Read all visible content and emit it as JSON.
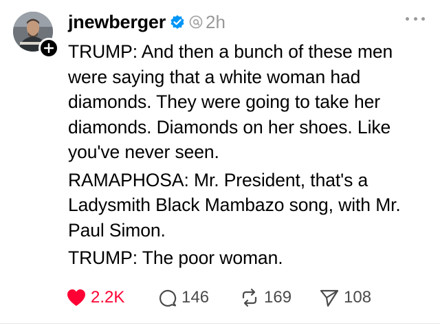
{
  "post": {
    "username": "jnewberger",
    "timestamp": "2h",
    "paragraphs": [
      "TRUMP: And then a bunch of these men were saying that a white woman had diamonds. They were going to take her diamonds. Diamonds on her shoes. Like you've never seen.",
      "RAMAPHOSA: Mr. President, that's a Ladysmith Black Mambazo song, with Mr. Paul Simon.",
      "TRUMP: The poor woman."
    ]
  },
  "actions": {
    "likes": "2.2K",
    "replies": "146",
    "reposts": "169",
    "shares": "108"
  },
  "colors": {
    "like_active": "#ff0034",
    "verified": "#0095f6",
    "muted_text": "#999999"
  },
  "icons": [
    "verified-badge-icon",
    "threads-icon",
    "more-icon",
    "heart-icon",
    "reply-icon",
    "repost-icon",
    "share-icon",
    "follow-plus-icon"
  ]
}
